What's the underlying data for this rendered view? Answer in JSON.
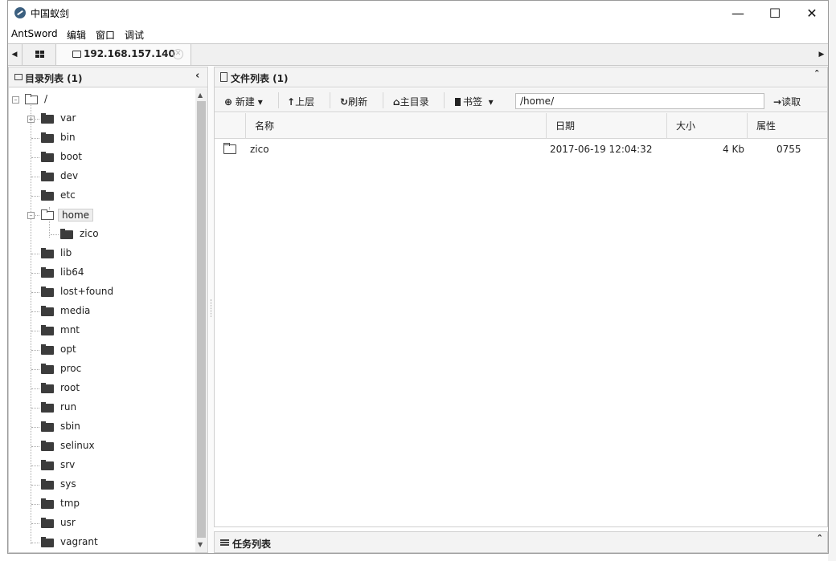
{
  "window": {
    "title": "中国蚁剑"
  },
  "menu": [
    "AntSword",
    "编辑",
    "窗口",
    "调试"
  ],
  "tabs": {
    "active_host": "192.168.157.140"
  },
  "dir_panel": {
    "title": "目录列表 (1)",
    "collapse_glyph": "‹"
  },
  "tree": {
    "root": "/",
    "items": [
      "var",
      "bin",
      "boot",
      "dev",
      "etc",
      "home",
      "zico",
      "lib",
      "lib64",
      "lost+found",
      "media",
      "mnt",
      "opt",
      "proc",
      "root",
      "run",
      "sbin",
      "selinux",
      "srv",
      "sys",
      "tmp",
      "usr",
      "vagrant"
    ]
  },
  "file_panel": {
    "title": "文件列表 (1)",
    "toolbar": {
      "new": "新建",
      "up": "上层",
      "refresh": "刷新",
      "home": "主目录",
      "bookmark": "书签",
      "path_value": "/home/",
      "read": "读取"
    },
    "columns": [
      "名称",
      "日期",
      "大小",
      "属性"
    ],
    "rows": [
      {
        "name": "zico",
        "date": "2017-06-19 12:04:32",
        "size": "4 Kb",
        "attr": "0755"
      }
    ]
  },
  "task_panel": {
    "title": "任务列表"
  }
}
